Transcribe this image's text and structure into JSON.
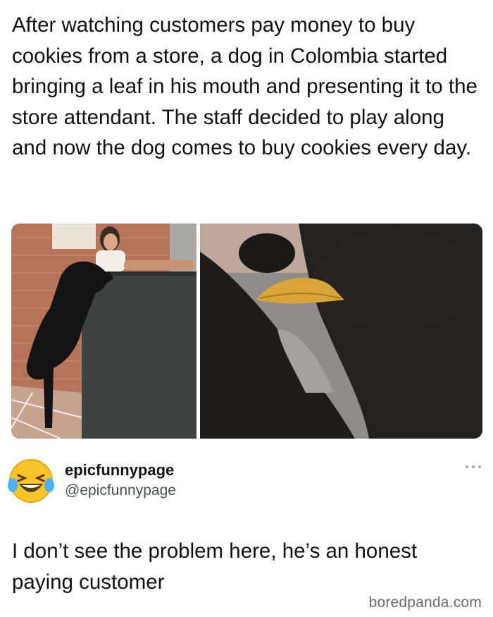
{
  "post": {
    "text": "After watching customers pay money to buy cookies from a store, a dog in Colombia started bringing a leaf in his mouth and presenting it to the store attendant. The staff decided to play along and now the dog comes to buy cookies every day."
  },
  "reply": {
    "display_name": "epicfunnypage",
    "handle": "@epicfunnypage",
    "avatar_icon": "laughing-crying-emoji-icon",
    "more_icon": "more-dots-icon",
    "text": "I don’t see the problem here, he’s an honest paying customer"
  },
  "watermark": "boredpanda.com",
  "colors": {
    "text": "#0f1419",
    "handle": "#4a4f55",
    "watermark": "#6b6b6b",
    "emoji_face": "#f7c52a"
  }
}
